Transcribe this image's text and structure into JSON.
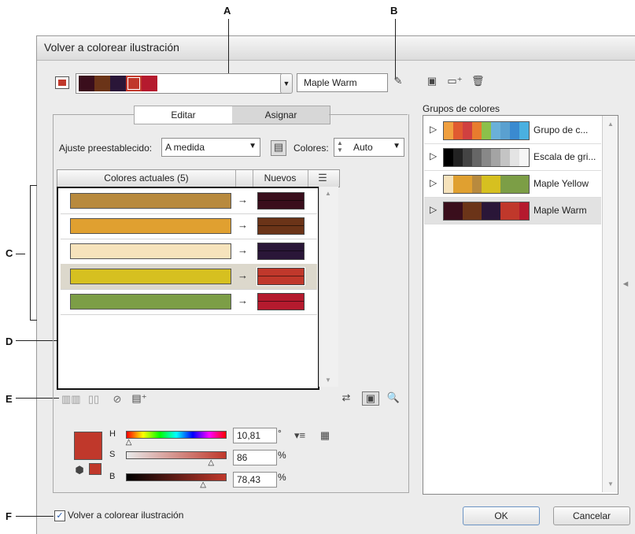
{
  "callouts": {
    "a": "A",
    "b": "B",
    "c": "C",
    "d": "D",
    "e": "E",
    "f": "F"
  },
  "window": {
    "title": "Volver a colorear ilustración"
  },
  "active_group": {
    "name": "Maple Warm",
    "swatches": [
      "#3a0e1c",
      "#6b3418",
      "#2a1638",
      "#c0382b",
      "#b51a2e"
    ]
  },
  "tabs": [
    {
      "label": "Editar",
      "active": true
    },
    {
      "label": "Asignar",
      "active": false
    }
  ],
  "preset": {
    "label": "Ajuste preestablecido:",
    "value": "A medida"
  },
  "colors_count": {
    "label": "Colores:",
    "value": "Auto"
  },
  "table": {
    "header_current": "Colores actuales (5)",
    "header_new": "Nuevos",
    "arrow": "→",
    "rows": [
      {
        "current": "#b88a3e",
        "new": "#3a0e1c",
        "selected": false
      },
      {
        "current": "#e0a030",
        "new": "#6b3418",
        "selected": false
      },
      {
        "current": "#f6e3bc",
        "new": "#2a1638",
        "selected": false
      },
      {
        "current": "#d6c020",
        "new": "#c0382b",
        "selected": true
      },
      {
        "current": "#7c9e46",
        "new": "#b51a2e",
        "selected": false
      }
    ]
  },
  "color_groups": {
    "label": "Grupos de colores",
    "items": [
      {
        "name": "Grupo de c...",
        "colors": [
          "#f0a040",
          "#e05a30",
          "#d04040",
          "#e87c2e",
          "#8cc04a",
          "#6ab0d8",
          "#5aa0d0",
          "#3a8ad0",
          "#4ab0e0"
        ],
        "selected": false
      },
      {
        "name": "Escala de gri...",
        "colors": [
          "#000000",
          "#222222",
          "#444444",
          "#666666",
          "#888888",
          "#a4a4a4",
          "#c4c4c4",
          "#e4e4e4",
          "#f6f6f6"
        ],
        "selected": false
      },
      {
        "name": "Maple Yellow",
        "colors": [
          "#f6e3bc",
          "#e0a030",
          "#e0a030",
          "#b88a3e",
          "#d6c020",
          "#d6c020",
          "#7c9e46",
          "#7c9e46",
          "#7c9e46"
        ],
        "selected": false
      },
      {
        "name": "Maple Warm",
        "colors": [
          "#3a0e1c",
          "#3a0e1c",
          "#6b3418",
          "#6b3418",
          "#2a1638",
          "#2a1638",
          "#c0382b",
          "#c0382b",
          "#b51a2e"
        ],
        "selected": true
      }
    ]
  },
  "hsb": {
    "h_label": "H",
    "h_value": "10,81",
    "h_unit": "°",
    "h_level": 0.03,
    "s_label": "S",
    "s_value": "86",
    "s_unit": "%",
    "s_level": 0.86,
    "b_label": "B",
    "b_value": "78,43",
    "b_unit": "%",
    "b_level": 0.78,
    "color": "#c0382b"
  },
  "recolor_checkbox": {
    "label": "Volver a colorear ilustración",
    "checked": true
  },
  "buttons": {
    "ok": "OK",
    "cancel": "Cancelar"
  }
}
